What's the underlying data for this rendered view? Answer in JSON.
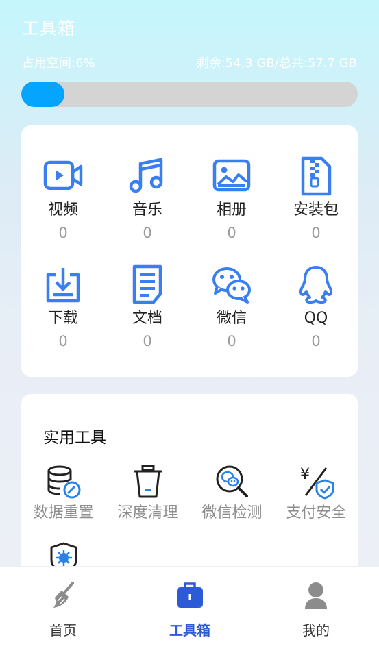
{
  "header": {
    "title": "工具箱",
    "used_label": "占用空间:6%",
    "remaining_label": "剩余:54.3 GB/总共:57.7 GB",
    "used_fraction": 0.06
  },
  "files": [
    {
      "label": "视频",
      "count": "0",
      "icon": "video-icon"
    },
    {
      "label": "音乐",
      "count": "0",
      "icon": "music-icon"
    },
    {
      "label": "相册",
      "count": "0",
      "icon": "photo-album-icon"
    },
    {
      "label": "安装包",
      "count": "0",
      "icon": "zip-package-icon"
    },
    {
      "label": "下载",
      "count": "0",
      "icon": "download-icon"
    },
    {
      "label": "文档",
      "count": "0",
      "icon": "document-icon"
    },
    {
      "label": "微信",
      "count": "0",
      "icon": "wechat-icon"
    },
    {
      "label": "QQ",
      "count": "0",
      "icon": "qq-icon"
    }
  ],
  "tools": {
    "title": "实用工具",
    "items": [
      {
        "label": "数据重置",
        "icon": "database-reset-icon"
      },
      {
        "label": "深度清理",
        "icon": "trash-can-icon"
      },
      {
        "label": "微信检测",
        "icon": "wechat-scan-icon"
      },
      {
        "label": "支付安全",
        "icon": "payment-shield-icon"
      },
      {
        "label": "",
        "icon": "virus-shield-icon"
      }
    ]
  },
  "tabbar": {
    "items": [
      {
        "label": "首页",
        "icon": "broom-icon",
        "active": false
      },
      {
        "label": "工具箱",
        "icon": "toolbox-icon",
        "active": true
      },
      {
        "label": "我的",
        "icon": "user-icon",
        "active": false
      }
    ]
  },
  "colors": {
    "accent": "#3a7ff2",
    "progress": "#05a5ff",
    "active_tab": "#2d5bd6"
  }
}
